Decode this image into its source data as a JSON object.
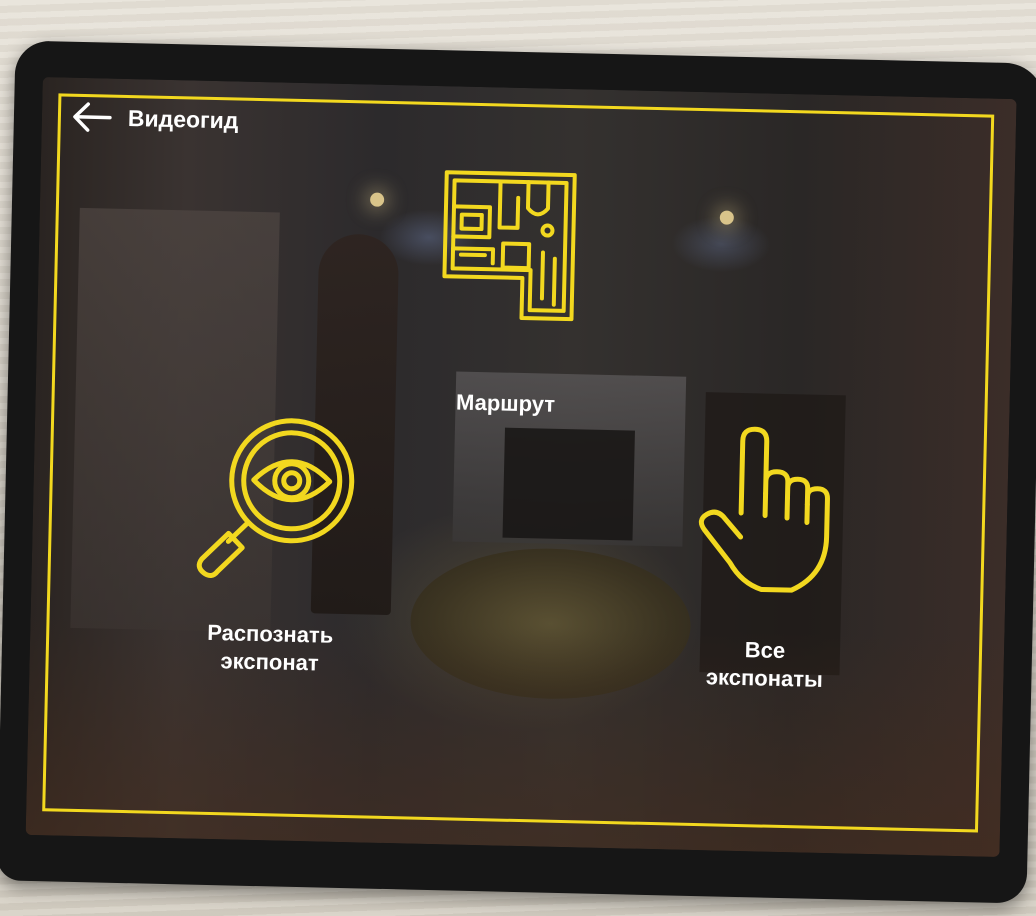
{
  "screen": {
    "title": "Видеогид",
    "accent_color": "#f2d81f",
    "back_icon": "arrow-left-icon"
  },
  "tiles": [
    {
      "id": "route",
      "label_lines": [
        "Маршрут"
      ],
      "icon": "floor-plan-icon"
    },
    {
      "id": "recognize",
      "label_lines": [
        "Распознать",
        "экспонат"
      ],
      "icon": "magnifier-eye-icon"
    },
    {
      "id": "all",
      "label_lines": [
        "Все",
        "экспонаты"
      ],
      "icon": "pointing-hand-icon"
    }
  ]
}
